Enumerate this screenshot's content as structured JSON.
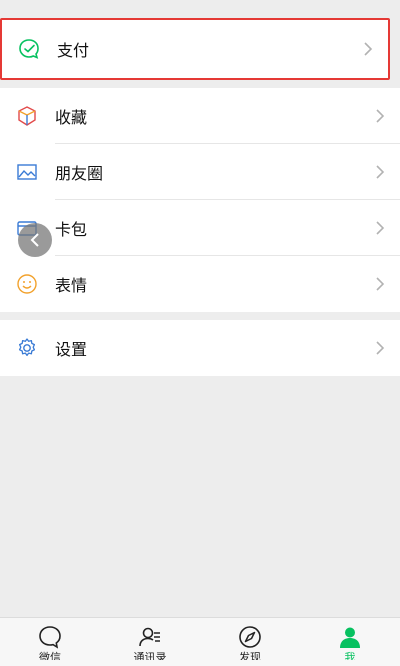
{
  "menu": {
    "pay": {
      "label": "支付",
      "icon": "wallet-icon"
    },
    "items_group1": [
      {
        "label": "收藏",
        "icon": "favorites-cube-icon"
      },
      {
        "label": "朋友圈",
        "icon": "moments-picture-icon"
      },
      {
        "label": "卡包",
        "icon": "card-wallet-icon"
      },
      {
        "label": "表情",
        "icon": "sticker-smile-icon"
      }
    ],
    "settings": {
      "label": "设置",
      "icon": "gear-icon"
    }
  },
  "bottom_nav": {
    "items": [
      {
        "label": "微信",
        "icon": "chat-bubble-icon",
        "active": false
      },
      {
        "label": "通讯录",
        "icon": "contacts-icon",
        "active": false
      },
      {
        "label": "发现",
        "icon": "compass-icon",
        "active": false
      },
      {
        "label": "我",
        "icon": "me-person-icon",
        "active": true
      }
    ]
  },
  "colors": {
    "accent_green": "#07c160",
    "highlight_border": "#e53935",
    "background": "#ededed"
  }
}
